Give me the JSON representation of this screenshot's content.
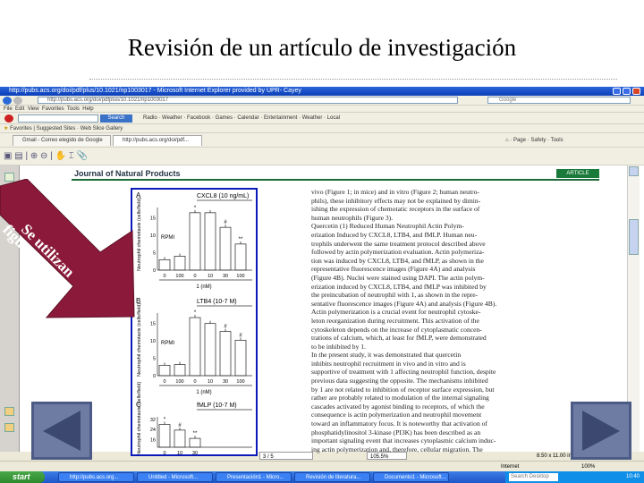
{
  "slide": {
    "title": "Revisión de un artículo de investigación",
    "callout": [
      "Se utilizan",
      "figuras"
    ]
  },
  "browser": {
    "window_title": "http://pubs.acs.org/doi/pdf/plus/10.1021/np1003017 - Microsoft Internet Explorer provided by UPR- Cayey",
    "address": "http://pubs.acs.org/doi/pdfplus/10.1021/np1003017",
    "search_placeholder": "Google",
    "menu": [
      "File",
      "Edit",
      "View",
      "Favorites",
      "Tools",
      "Help"
    ],
    "toolbar_search_button": "Search",
    "toolbar_links": [
      "Radio",
      "Weather",
      "Facebook",
      "Games",
      "Calendar",
      "Entertainment",
      "Weather",
      "Local"
    ],
    "favorites": [
      "Favorites",
      "Suggested Sites",
      "Web Slice Gallery"
    ],
    "tabs": [
      "Gmail - Correo elegido de Google",
      "http://pubs.acs.org/doi/pdf..."
    ],
    "command_bar": [
      "Page",
      "Safety",
      "Tools"
    ],
    "pdf": {
      "page": "3 / 5",
      "zoom": "105.5%",
      "size": "8.50 x 11.00 in"
    },
    "status": "Internet",
    "zoom_status": "100%"
  },
  "document": {
    "journal": "Journal of Natural Products",
    "badge": "ARTICLE",
    "paragraphs": [
      "vivo (Figure 1; in mice) and in vitro (Figure 2; human neutro-",
      "phils), these inhibitory effects may not be explained by dimin-",
      "ishing the expression of chemotatic receptors in the surface of",
      "human neutrophils (Figure 3).",
      "   Quercetin (1) Reduced Human Neutrophil Actin Polym-",
      "erization Induced by CXCL8, LTB4, and fMLP. Human neu-",
      "trophils underwent the same treatment protocol described above",
      "followed by actin polymerization evaluation. Actin polymeriza-",
      "tion was induced by CXCL8, LTB4, and fMLP, as shown in the",
      "representative fluorescence images (Figure 4A) and analysis",
      "(Figure 4B). Nuclei were stained using DAPI. The actin polym-",
      "erization induced by CXCL8, LTB4, and fMLP was inhibited by",
      "the preincubation of neutrophil with 1, as shown in the repre-",
      "sentative fluorescence images (Figure 4A) and analysis (Figure 4B).",
      "   Actin polymerization is a crucial event for neutrophil cytoske-",
      "leton reorganization during recruitment. This activation of the",
      "cytoskeleton depends on the increase of cytoplasmatic concen-",
      "trations of calcium, which, at least for fMLP, were demonstrated",
      "to be inhibited by 1.",
      "   In the present study, it was demonstrated that quercetin",
      "inhibits neutrophil recruitment in vivo and in vitro and is",
      "supportive of treatment with 1 affecting neutrophil function, despite",
      "previous data suggesting the opposite. The mechanisms inhibited",
      "by 1 are not related to inhibition of receptor surface expression, but",
      "rather are probably related to modulation of the internal signaling",
      "cascades activated by agonist binding to receptors, of which the",
      "consequence is actin polymerization and neutrophil movement",
      "toward an inflammatory focus. It is noteworthy that activation of",
      "phosphatidylinositol 3-kinase (PI3K) has been described as an",
      "important signaling event that increases cytoplasmic calcium induc-",
      "ing actin polymerization and, therefore, cellular migration. The"
    ]
  },
  "taskbar": {
    "start": "start",
    "tasks": [
      "http://pubs.acs.org...",
      "Untitled - Microsoft...",
      "Presentación1 - Micro...",
      "Revisión de literatura...",
      "Documento1 - Microsoft..."
    ],
    "search": "Search Desktop",
    "clock": "10:40"
  },
  "chart_data": [
    {
      "type": "bar",
      "panel": "A",
      "group_label": "CXCL8 (10 ng/mL)",
      "control_label": "RPMI",
      "ylabel": "Neutrophil chemotaxis (cells/field)",
      "xlabel": "1 (nM)",
      "categories": [
        "0",
        "100",
        "0",
        "10",
        "30",
        "100"
      ],
      "values": [
        3,
        4,
        16.5,
        16.5,
        12.3,
        7.5
      ],
      "annotations": [
        "",
        "",
        "*",
        "",
        "#",
        "**"
      ],
      "yticks": [
        0,
        5,
        10,
        15
      ],
      "ylim": [
        0,
        18
      ]
    },
    {
      "type": "bar",
      "panel": "B",
      "group_label": "LTB4 (10-7 M)",
      "control_label": "RPMI",
      "ylabel": "Neutrophil chemotaxis (cells/field)",
      "xlabel": "1 (nM)",
      "categories": [
        "0",
        "100",
        "0",
        "10",
        "30",
        "100"
      ],
      "values": [
        3,
        3.2,
        16.7,
        15,
        12.7,
        10.2
      ],
      "annotations": [
        "",
        "",
        "*",
        "",
        "#",
        "#"
      ],
      "yticks": [
        0,
        5,
        10,
        15
      ],
      "ylim": [
        0,
        18
      ]
    },
    {
      "type": "bar",
      "panel": "C",
      "group_label": "fMLP (10-7 M)",
      "ylabel": "Neutrophil chemotaxis (cells/field)",
      "categories": [
        "0",
        "10",
        "30"
      ],
      "values": [
        28,
        23.5,
        17
      ],
      "annotations": [
        "*",
        "#",
        "**"
      ],
      "yticks": [
        16,
        24,
        32
      ],
      "ylim": [
        10,
        34
      ]
    }
  ],
  "colors": {
    "arrow": "#8b1a3a",
    "figure_border": "#0a1ab8",
    "journal_green": "#1a7a3a",
    "nav_button": "#6e7ca4"
  }
}
